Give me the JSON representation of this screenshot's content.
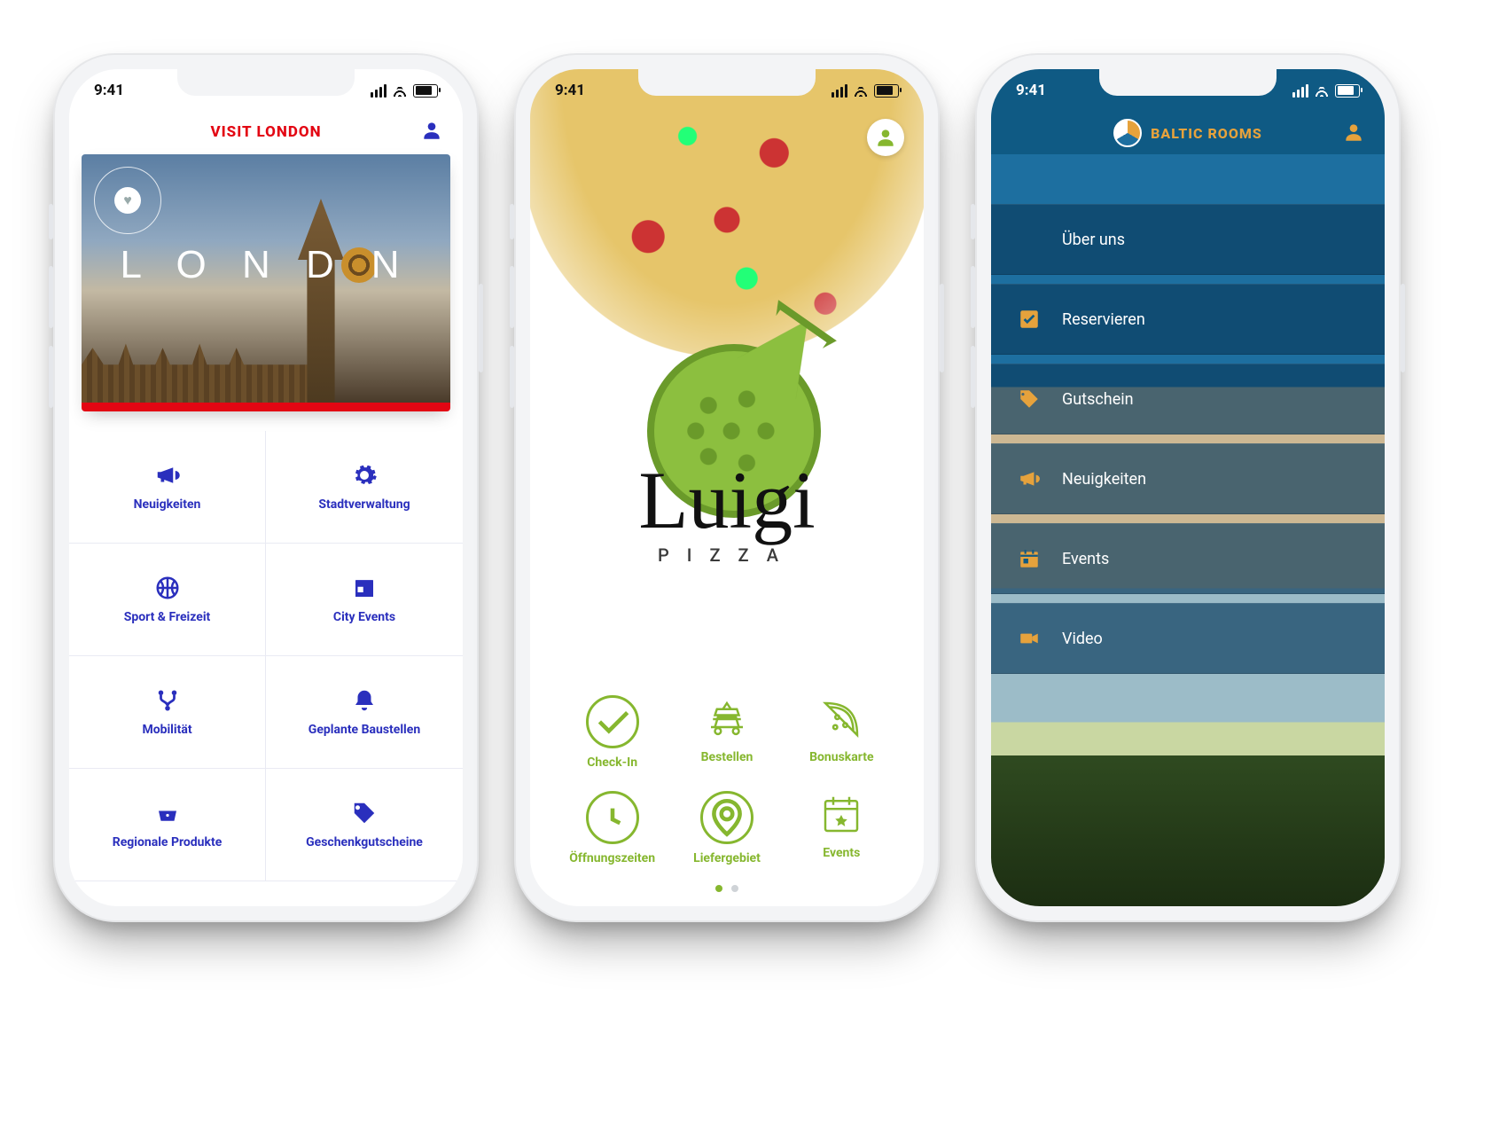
{
  "status_time": "9:41",
  "phone1": {
    "title": "VISIT LONDON",
    "hero_text_left": "L O N D",
    "hero_text_right": "N",
    "tiles": [
      {
        "label": "Neuigkeiten",
        "icon": "megaphone-icon"
      },
      {
        "label": "Stadtverwaltung",
        "icon": "gear-icon"
      },
      {
        "label": "Sport & Freizeit",
        "icon": "basketball-icon"
      },
      {
        "label": "City Events",
        "icon": "calendar-icon"
      },
      {
        "label": "Mobilität",
        "icon": "fork-icon"
      },
      {
        "label": "Geplante Baustellen",
        "icon": "bell-icon"
      },
      {
        "label": "Regionale Produkte",
        "icon": "basket-icon"
      },
      {
        "label": "Geschenkgutscheine",
        "icon": "tag-icon"
      }
    ]
  },
  "phone2": {
    "brand": "Luigi",
    "subtitle": "PIZZA",
    "tiles": [
      {
        "label": "Check-In",
        "icon": "check-icon"
      },
      {
        "label": "Bestellen",
        "icon": "car-icon"
      },
      {
        "label": "Bonuskarte",
        "icon": "pizza-slice-icon"
      },
      {
        "label": "Öffnungszeiten",
        "icon": "clock-icon"
      },
      {
        "label": "Liefergebiet",
        "icon": "pin-icon"
      },
      {
        "label": "Events",
        "icon": "calendar-star-icon"
      }
    ]
  },
  "phone3": {
    "title": "BALTIC ROOMS",
    "items": [
      {
        "label": "Über uns",
        "icon": "lines-icon"
      },
      {
        "label": "Reservieren",
        "icon": "checkbox-icon"
      },
      {
        "label": "Gutschein",
        "icon": "tag-icon"
      },
      {
        "label": "Neuigkeiten",
        "icon": "megaphone-icon"
      },
      {
        "label": "Events",
        "icon": "calendar-icon"
      },
      {
        "label": "Video",
        "icon": "video-icon"
      }
    ]
  }
}
